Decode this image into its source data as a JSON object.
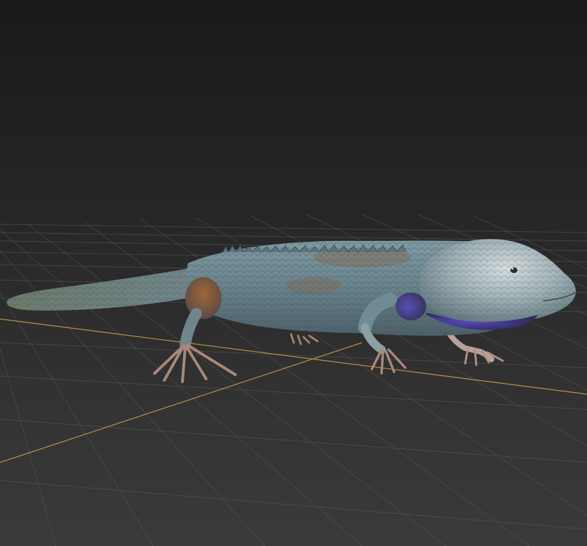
{
  "viewport": {
    "kind": "3d-perspective-viewport",
    "background_top": "#1a1a1a",
    "background_bottom": "#3a3a3a",
    "grid_color": "#5a5a5a",
    "axis_color": "#b8934a"
  },
  "model": {
    "subject": "lizard",
    "skin_base_color": "#6f8a93",
    "skin_highlight_color": "#c9d3d4",
    "accent_rust_color": "#8a5a38",
    "throat_color": "#4a3a9a",
    "claw_color": "#a8887a"
  }
}
